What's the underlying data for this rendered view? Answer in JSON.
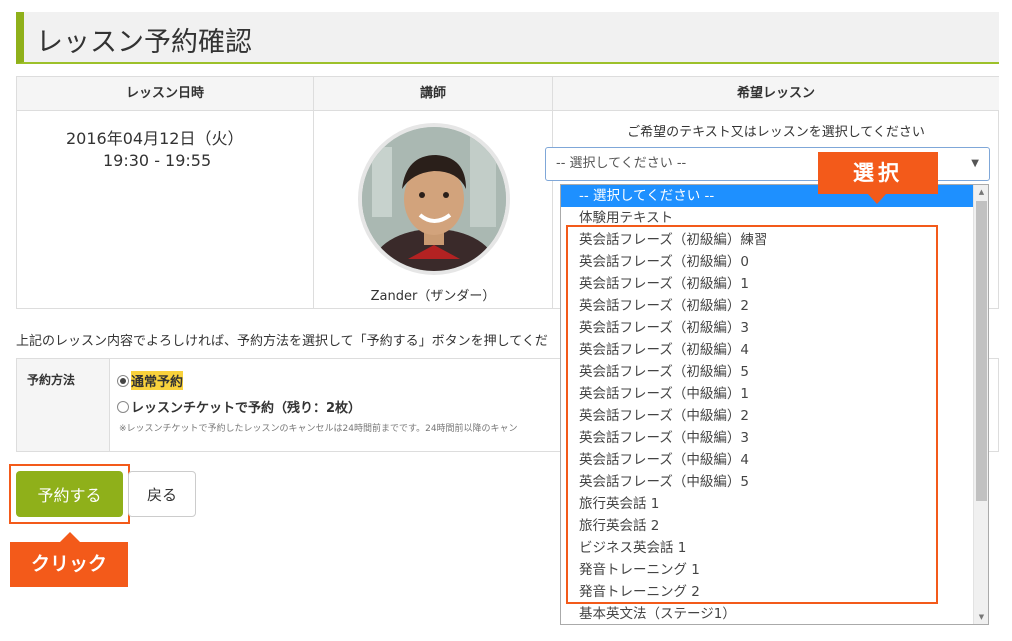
{
  "page": {
    "title": "レッスン予約確認"
  },
  "lesson_table": {
    "headers": {
      "datetime": "レッスン日時",
      "teacher": "講師",
      "lesson": "希望レッスン"
    },
    "date": "2016年04月12日（火）",
    "time": "19:30 - 19:55",
    "teacher_name": "Zander（ザンダー）",
    "lesson_note": "ご希望のテキスト又はレッスンを選択してください"
  },
  "lesson_select": {
    "current": "-- 選択してください --",
    "options": [
      "-- 選択してください --",
      "体験用テキスト",
      "英会話フレーズ（初級編）練習",
      "英会話フレーズ（初級編）0",
      "英会話フレーズ（初級編）1",
      "英会話フレーズ（初級編）2",
      "英会話フレーズ（初級編）3",
      "英会話フレーズ（初級編）4",
      "英会話フレーズ（初級編）5",
      "英会話フレーズ（中級編）1",
      "英会話フレーズ（中級編）2",
      "英会話フレーズ（中級編）3",
      "英会話フレーズ（中級編）4",
      "英会話フレーズ（中級編）5",
      "旅行英会話 1",
      "旅行英会話 2",
      "ビジネス英会話 1",
      "発音トレーニング 1",
      "発音トレーニング 2",
      "基本英文法（ステージ1）"
    ]
  },
  "instructions": "上記のレッスン内容でよろしければ、予約方法を選択して「予約する」ボタンを押してくだ",
  "reservation_method": {
    "label": "予約方法",
    "options": [
      "通常予約",
      "レッスンチケットで予約（残り：2枚）"
    ],
    "selected_index": 0,
    "note": "※レッスンチケットで予約したレッスンのキャンセルは24時間前までです。24時間前以降のキャン"
  },
  "buttons": {
    "reserve": "予約する",
    "back": "戻る"
  },
  "annotations": {
    "click": "クリック",
    "select": "選択"
  },
  "colors": {
    "accent_green": "#8fb01a",
    "callout_orange": "#f35a1a",
    "dropdown_selected": "#1e90ff",
    "highlight_yellow": "#f9d23c"
  },
  "icons": {
    "teacher_avatar": "teacher-photo",
    "select_arrow": "triangle-down"
  }
}
